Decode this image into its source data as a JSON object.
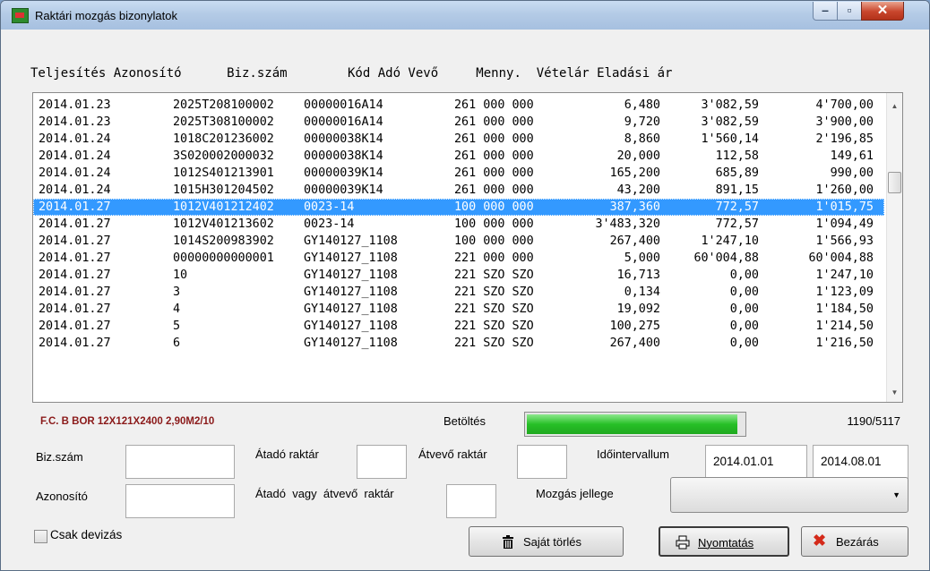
{
  "window": {
    "title": "Raktári mozgás bizonylatok"
  },
  "header_line": "Teljesítés Azonosító      Biz.szám        Kód Adó Vevő     Menny.  Vételár Eladási ár",
  "rows": [
    {
      "d": "2014.01.23",
      "id": "2025T208100002",
      "biz": "00000016A14",
      "kav": "261 000 000",
      "menny": "6,480",
      "vetel": "3'082,59",
      "elad": "4'700,00"
    },
    {
      "d": "2014.01.23",
      "id": "2025T308100002",
      "biz": "00000016A14",
      "kav": "261 000 000",
      "menny": "9,720",
      "vetel": "3'082,59",
      "elad": "3'900,00"
    },
    {
      "d": "2014.01.24",
      "id": "1018C201236002",
      "biz": "00000038K14",
      "kav": "261 000 000",
      "menny": "8,860",
      "vetel": "1'560,14",
      "elad": "2'196,85"
    },
    {
      "d": "2014.01.24",
      "id": "3S020002000032",
      "biz": "00000038K14",
      "kav": "261 000 000",
      "menny": "20,000",
      "vetel": "112,58",
      "elad": "149,61"
    },
    {
      "d": "2014.01.24",
      "id": "1012S401213901",
      "biz": "00000039K14",
      "kav": "261 000 000",
      "menny": "165,200",
      "vetel": "685,89",
      "elad": "990,00"
    },
    {
      "d": "2014.01.24",
      "id": "1015H301204502",
      "biz": "00000039K14",
      "kav": "261 000 000",
      "menny": "43,200",
      "vetel": "891,15",
      "elad": "1'260,00"
    },
    {
      "d": "2014.01.27",
      "id": "1012V401212402",
      "biz": "0023-14",
      "kav": "100 000 000",
      "menny": "387,360",
      "vetel": "772,57",
      "elad": "1'015,75",
      "selected": true
    },
    {
      "d": "2014.01.27",
      "id": "1012V401213602",
      "biz": "0023-14",
      "kav": "100 000 000",
      "menny": "3'483,320",
      "vetel": "772,57",
      "elad": "1'094,49"
    },
    {
      "d": "2014.01.27",
      "id": "1014S200983902",
      "biz": "GY140127_1108",
      "kav": "100 000 000",
      "menny": "267,400",
      "vetel": "1'247,10",
      "elad": "1'566,93"
    },
    {
      "d": "2014.01.27",
      "id": "00000000000001",
      "biz": "GY140127_1108",
      "kav": "221 000 000",
      "menny": "5,000",
      "vetel": "60'004,88",
      "elad": "60'004,88"
    },
    {
      "d": "2014.01.27",
      "id": "10",
      "biz": "GY140127_1108",
      "kav": "221 SZO SZO",
      "menny": "16,713",
      "vetel": "0,00",
      "elad": "1'247,10"
    },
    {
      "d": "2014.01.27",
      "id": "3",
      "biz": "GY140127_1108",
      "kav": "221 SZO SZO",
      "menny": "0,134",
      "vetel": "0,00",
      "elad": "1'123,09"
    },
    {
      "d": "2014.01.27",
      "id": "4",
      "biz": "GY140127_1108",
      "kav": "221 SZO SZO",
      "menny": "19,092",
      "vetel": "0,00",
      "elad": "1'184,50"
    },
    {
      "d": "2014.01.27",
      "id": "5",
      "biz": "GY140127_1108",
      "kav": "221 SZO SZO",
      "menny": "100,275",
      "vetel": "0,00",
      "elad": "1'214,50"
    },
    {
      "d": "2014.01.27",
      "id": "6",
      "biz": "GY140127_1108",
      "kav": "221 SZO SZO",
      "menny": "267,400",
      "vetel": "0,00",
      "elad": "1'216,50"
    }
  ],
  "status": {
    "item_info": "F.C. B BOR 12X121X2400 2,90M2/10",
    "loading_label": "Betöltés",
    "progress_fraction": 0.97,
    "count": "1190/5117"
  },
  "filters": {
    "biz_label": "Biz.szám",
    "atado_label": "Átadó raktár",
    "atvevo_label": "Átvevő raktár",
    "ido_label": "Időintervallum",
    "ido_from": "2014.01.01",
    "ido_to": "2014.08.01",
    "azon_label": "Azonosító",
    "atado_vagy_label": "Átadó  vagy  átvevő  raktár",
    "mozgas_label": "Mozgás jellege",
    "mozgas_value": ""
  },
  "checkbox": {
    "label": "Csak devizás",
    "checked": false
  },
  "buttons": {
    "delete": "Saját törlés",
    "print": "Nyomtatás",
    "close": "Bezárás"
  },
  "colors": {
    "selection": "#3399ff",
    "info_text": "#8b1a1a",
    "progress": "#27c027"
  }
}
